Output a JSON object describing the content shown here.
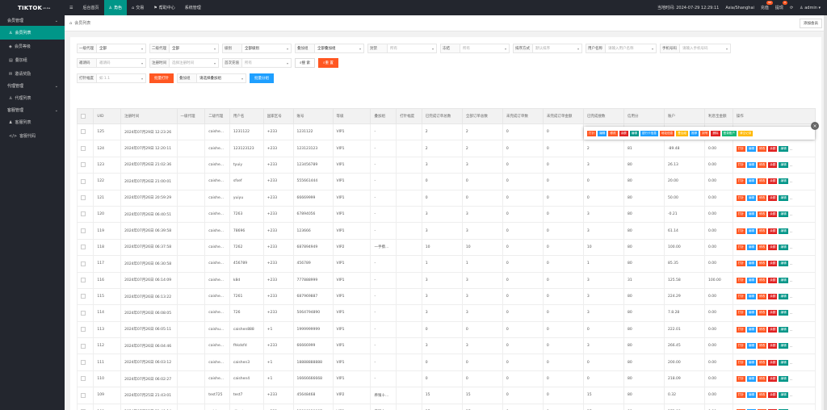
{
  "topbar": {
    "logo": "TIKTOK",
    "logo_sup": "ok.be",
    "menu_icon": "☰",
    "nav": [
      {
        "label": "后台首页",
        "icon": ""
      },
      {
        "label": "角色",
        "icon": "♙",
        "active": true
      },
      {
        "label": "交易",
        "icon": "⌂"
      },
      {
        "label": "帮助中心",
        "icon": "⚑"
      },
      {
        "label": "系统管理",
        "icon": ""
      }
    ],
    "time_label": "当地时间:",
    "time_value": "2024-07-29 12:29:11",
    "timezone": "Asia/Shanghai",
    "recharge": "充值",
    "recharge_badge": "99",
    "withdraw": "提现",
    "withdraw_badge": "0",
    "refresh_icon": "⟳",
    "user": "admin",
    "colors": {
      "topbar": "#23262e",
      "accent": "#009688"
    }
  },
  "sidebar": {
    "groups": [
      {
        "label": "会员管理",
        "items": [
          {
            "label": "会员列表",
            "icon": "♙",
            "active": true
          },
          {
            "label": "会员等级",
            "icon": "◈"
          },
          {
            "label": "叠加组",
            "icon": "▤"
          },
          {
            "label": "邀请奖励",
            "icon": "✉"
          }
        ]
      },
      {
        "label": "代理管理",
        "items": [
          {
            "label": "代理列表",
            "icon": "♙"
          }
        ]
      },
      {
        "label": "客服管理",
        "items": [
          {
            "label": "客服列表",
            "icon": "♟"
          },
          {
            "label": "客服代码",
            "icon": "</>"
          }
        ]
      }
    ]
  },
  "tabbar": {
    "tab": "会员列表",
    "add_button": "添加会员"
  },
  "filters": {
    "row1": [
      {
        "label": "一级代理",
        "value": "全部",
        "w": 62
      },
      {
        "label": "二级代理",
        "value": "全部",
        "w": 62
      },
      {
        "label": "级别",
        "value": "全部级别",
        "w": 62
      },
      {
        "label": "叠加组",
        "value": "全部叠加组",
        "w": 62
      },
      {
        "label": "封禁",
        "value": "所有",
        "w": 62,
        "ph": true
      },
      {
        "label": "冻结",
        "value": "所有",
        "w": 62,
        "ph": true
      },
      {
        "label": "排序方式",
        "value": "默认排序",
        "w": 62,
        "ph": true
      },
      {
        "label": "用户名称",
        "value": "请输入用户名称",
        "w": 64,
        "ph": true
      },
      {
        "label": "手机号码",
        "value": "请输入手机号码",
        "w": 64,
        "ph": true
      }
    ],
    "row2": [
      {
        "label": "邀请码",
        "value": "邀请码",
        "w": 62,
        "ph": true
      },
      {
        "label": "注册时间",
        "value": "选择注册时间",
        "w": 62,
        "ph": true
      },
      {
        "label": "首次充值",
        "value": "所有",
        "w": 62,
        "ph": true
      }
    ],
    "search_button": "搜 索",
    "reset_button": "重 置",
    "row3": [
      {
        "label": "打针幅度",
        "value": "如 1.1",
        "w": 62,
        "ph": true
      }
    ],
    "batch_inject": "批量打针",
    "row3b": [
      {
        "label": "叠加组",
        "value": "请选择叠加组",
        "w": 62
      }
    ],
    "batch_group": "批量分组"
  },
  "table": {
    "headers": [
      "",
      "UID",
      "注册时间",
      "一级代理",
      "二级代理",
      "用户名",
      "国家区号",
      "账号",
      "等级",
      "叠加组",
      "打针幅度",
      "已完成订单总数",
      "全部订单总数",
      "未完成订单数",
      "未完成订单金额",
      "已完成搜数",
      "信用分",
      "账户",
      "利息宝金额",
      "操作"
    ],
    "rows": [
      [
        "125",
        "2024年07月29日 12:23:26",
        "",
        "caishe...",
        "1231122",
        "+233",
        "1231122",
        "VIP1",
        "-",
        "",
        "2",
        "2",
        "0",
        "0",
        "",
        "",
        "",
        ""
      ],
      [
        "124",
        "2024年07月29日 12:20:11",
        "",
        "caishe...",
        "123123123",
        "+233",
        "123123123",
        "VIP1",
        "-",
        "",
        "2",
        "2",
        "0",
        "0",
        "2",
        "81",
        "-89.48",
        "0.00"
      ],
      [
        "123",
        "2024年07月26日 21:02:36",
        "",
        "caishe...",
        "tyuiy",
        "+233",
        "123456789",
        "VIP1",
        "-",
        "",
        "3",
        "3",
        "0",
        "0",
        "3",
        "80",
        "26.13",
        "0.00"
      ],
      [
        "122",
        "2024年07月26日 21:00:01",
        "",
        "caishe...",
        "sfsef",
        "+233",
        "555661444",
        "VIP1",
        "-",
        "",
        "0",
        "0",
        "0",
        "0",
        "0",
        "80",
        "20.00",
        "0.00"
      ],
      [
        "121",
        "2024年07月26日 20:59:29",
        "",
        "caishe...",
        "yuiyu",
        "+233",
        "66669999",
        "VIP1",
        "-",
        "",
        "0",
        "0",
        "0",
        "0",
        "0",
        "80",
        "50.00",
        "0.00"
      ],
      [
        "120",
        "2024年07月26日 06:40:51",
        "",
        "caishe...",
        "7263",
        "+233",
        "67894056",
        "VIP1",
        "-",
        "",
        "3",
        "3",
        "0",
        "0",
        "3",
        "80",
        "-0.21",
        "0.00"
      ],
      [
        "119",
        "2024年07月26日 06:39:58",
        "",
        "caishe...",
        "78696",
        "+233",
        "123666",
        "VIP1",
        "-",
        "",
        "3",
        "3",
        "0",
        "0",
        "3",
        "80",
        "61.14",
        "0.00"
      ],
      [
        "118",
        "2024年07月26日 06:37:58",
        "",
        "caishe...",
        "7262",
        "+233",
        "687894949",
        "VIP2",
        "一手摸...",
        "",
        "10",
        "10",
        "0",
        "0",
        "10",
        "80",
        "100.00",
        "0.00"
      ],
      [
        "117",
        "2024年07月26日 06:30:58",
        "",
        "caishe...",
        "456789",
        "+233",
        "456789",
        "VIP1",
        "-",
        "",
        "1",
        "1",
        "0",
        "0",
        "1",
        "80",
        "85.35",
        "0.00"
      ],
      [
        "116",
        "2024年07月26日 06:14:09",
        "",
        "caishe...",
        "k8d",
        "+233",
        "777888999",
        "VIP1",
        "-",
        "",
        "3",
        "3",
        "0",
        "0",
        "3",
        "31",
        "125.58",
        "100.00"
      ],
      [
        "115",
        "2024年07月26日 06:13:22",
        "",
        "caishe...",
        "7261",
        "+233",
        "687969887",
        "VIP1",
        "-",
        "",
        "3",
        "3",
        "0",
        "0",
        "3",
        "80",
        "224.29",
        "0.00"
      ],
      [
        "114",
        "2024年07月26日 06:08:05",
        "",
        "caishe...",
        "726",
        "+233",
        "5064794890",
        "VIP1",
        "-",
        "",
        "3",
        "3",
        "0",
        "0",
        "3",
        "80",
        "7.8.28",
        "0.00"
      ],
      [
        "113",
        "2024年07月26日 06:05:11",
        "",
        "caishu...",
        "caishen888",
        "+1",
        "1999999999",
        "VIP1",
        "-",
        "",
        "0",
        "0",
        "0",
        "0",
        "0",
        "80",
        "222.01",
        "0.00"
      ],
      [
        "112",
        "2024年07月26日 06:04:46",
        "",
        "caishe...",
        "fhkdsfd",
        "+233",
        "66666999",
        "VIP1",
        "-",
        "",
        "3",
        "3",
        "0",
        "0",
        "3",
        "80",
        "266.45",
        "0.00"
      ],
      [
        "111",
        "2024年07月26日 06:03:12",
        "",
        "caishe...",
        "caishen3",
        "+1",
        "18888888888",
        "VIP1",
        "-",
        "",
        "0",
        "0",
        "0",
        "0",
        "0",
        "80",
        "200.00",
        "0.00"
      ],
      [
        "110",
        "2024年07月26日 06:02:27",
        "",
        "caishe...",
        "caishen4",
        "+1",
        "16666666668",
        "VIP1",
        "-",
        "",
        "0",
        "0",
        "0",
        "0",
        "0",
        "80",
        "218.09",
        "0.00"
      ],
      [
        "109",
        "2024年07月25日 21:43:01",
        "",
        "test725",
        "test7",
        "+233",
        "45648468",
        "VIP2",
        "养殖十...",
        "",
        "15",
        "15",
        "0",
        "0",
        "15",
        "80",
        "0.32",
        "0.00"
      ],
      [
        "108",
        "2024年07月25日 21:40:14",
        "",
        "caishe...",
        "d'test",
        "+233",
        "13800138087",
        "VIP1",
        "养殖十...",
        "",
        "37",
        "37",
        "0",
        "0",
        "37",
        "80",
        "272.88",
        "0.00"
      ]
    ],
    "row_ops": [
      {
        "label": "打针",
        "color": "or"
      },
      {
        "label": "编辑",
        "color": "bl"
      },
      {
        "label": "修改",
        "color": "or"
      },
      {
        "label": "余额",
        "color": "rd"
      },
      {
        "label": "编辑",
        "color": "gr"
      },
      {
        "label": "...",
        "color": "none"
      }
    ]
  },
  "popup": {
    "buttons": [
      {
        "label": "打针",
        "color": "or"
      },
      {
        "label": "编辑",
        "color": "bl"
      },
      {
        "label": "修改",
        "color": "or"
      },
      {
        "label": "余额",
        "color": "rd"
      },
      {
        "label": "编辑",
        "color": "gr"
      },
      {
        "label": "银行卡信息",
        "color": "bl"
      },
      {
        "label": "地址信息",
        "color": "or"
      },
      {
        "label": "叠加组",
        "color": "ye"
      },
      {
        "label": "推荐",
        "color": "bl"
      },
      {
        "label": "封号",
        "color": "or"
      },
      {
        "label": "删除",
        "color": "rd"
      },
      {
        "label": "登录账户",
        "color": "dg"
      },
      {
        "label": "清空记录",
        "color": "ye"
      }
    ],
    "close_icon": "×"
  }
}
